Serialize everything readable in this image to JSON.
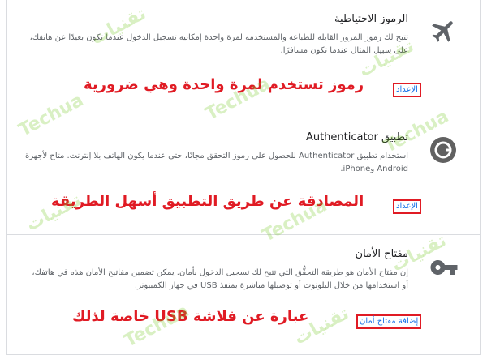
{
  "sections": [
    {
      "icon": "airplane-icon",
      "title": "الرموز الاحتياطية",
      "description": "تتيح لك رموز المرور القابلة للطباعة والمستخدمة لمرة واحدة إمكانية تسجيل الدخول عندما تكون بعيدًا عن هاتفك، على سبيل المثال عندما تكون مسافرًا.",
      "action_label": "الإعداد",
      "annotation": "رموز تستخدم لمرة واحدة وهي ضرورية"
    },
    {
      "icon": "authenticator-icon",
      "title": "تطبيق Authenticator",
      "description": "استخدام تطبيق Authenticator للحصول على رموز التحقق مجانًا، حتى عندما يكون الهاتف بلا إنترنت. متاح لأجهزة Android وiPhone.",
      "action_label": "الإعداد",
      "annotation": "المصادقة عن طريق التطبيق أسهل الطريقة"
    },
    {
      "icon": "key-icon",
      "title": "مفتاح الأمان",
      "description": "إن مفتاح الأمان هو طريقة التحقُّق التي تتيح لك تسجيل الدخول بأمان. يمكن تضمين مفاتيح الأمان هذه في هاتفك، أو استخدامها من خلال البلوتوث أو توصيلها مباشرة بمنفذ USB في جهاز الكمبيوتر.",
      "action_label": "إضافة مفتاح أمان",
      "annotation": "عبارة عن فلاشة USB خاصة لذلك"
    }
  ],
  "watermark": {
    "latin": "Techua",
    "arabic": "تقنيات"
  },
  "colors": {
    "link": "#1a73e8",
    "annotation": "#e01b24",
    "icon": "#5f6368",
    "watermark": "#78c828"
  }
}
